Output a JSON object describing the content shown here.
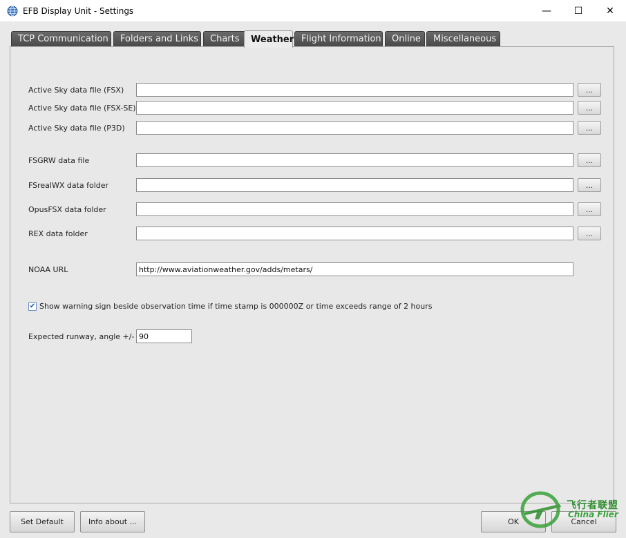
{
  "window": {
    "title": "EFB Display Unit - Settings",
    "controls": {
      "minimize": "—",
      "maximize": "☐",
      "close": "✕"
    }
  },
  "tabs": [
    {
      "label": "TCP Communication",
      "active": false
    },
    {
      "label": "Folders and Links",
      "active": false
    },
    {
      "label": "Charts",
      "active": false
    },
    {
      "label": "Weather",
      "active": true
    },
    {
      "label": "Flight Information",
      "active": false
    },
    {
      "label": "Online",
      "active": false
    },
    {
      "label": "Miscellaneous",
      "active": false
    }
  ],
  "weather": {
    "fields": [
      {
        "label": "Active Sky data file (FSX)",
        "value": "",
        "browse": "..."
      },
      {
        "label": "Active Sky data file (FSX-SE)",
        "value": "",
        "browse": "..."
      },
      {
        "label": "Active Sky data file (P3D)",
        "value": "",
        "browse": "..."
      },
      {
        "label": "FSGRW data file",
        "value": "",
        "browse": "..."
      },
      {
        "label": "FSrealWX data folder",
        "value": "",
        "browse": "..."
      },
      {
        "label": "OpusFSX data folder",
        "value": "",
        "browse": "..."
      },
      {
        "label": "REX data folder",
        "value": "",
        "browse": "..."
      }
    ],
    "noaa": {
      "label": "NOAA URL",
      "value": "http://www.aviationweather.gov/adds/metars/"
    },
    "warning_checkbox": {
      "checked": true,
      "mark": "✔",
      "label": "Show warning sign beside observation time if time stamp is 000000Z or time exceeds range of 2 hours"
    },
    "runway": {
      "label": "Expected runway, angle +/-",
      "value": "90"
    }
  },
  "buttons": {
    "set_default": "Set Default",
    "info_about": "Info about ...",
    "ok": "OK",
    "cancel": "Cancel"
  },
  "watermark": {
    "cn": "飞行者联盟",
    "en": "China Flier"
  },
  "colors": {
    "tab_inactive": "#555555",
    "tab_active": "#ececec",
    "panel": "#e8e8e8",
    "accent_check": "#1f4f9f"
  }
}
